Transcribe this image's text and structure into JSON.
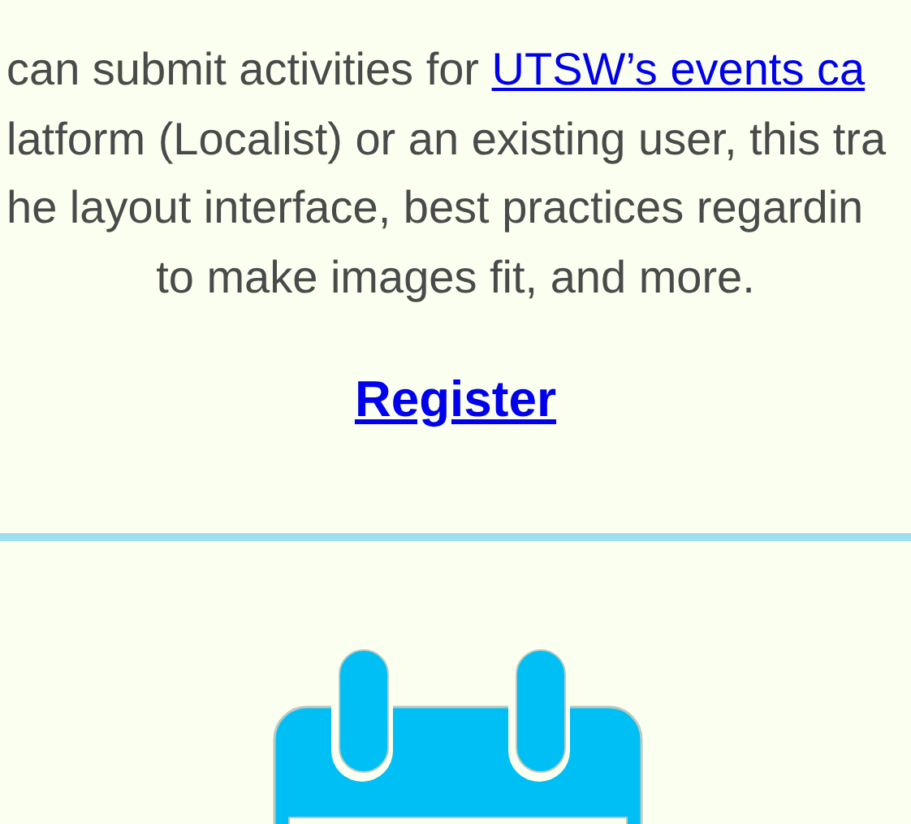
{
  "description": {
    "lines": [
      {
        "text": "can submit activities for ",
        "link": "UTSW’s events ca"
      },
      {
        "text": "latform (Localist) or an existing user, this tra"
      },
      {
        "text": "he layout interface, best practices regardin"
      },
      {
        "text": "to make images fit, and more."
      }
    ]
  },
  "register_link": "Register"
}
